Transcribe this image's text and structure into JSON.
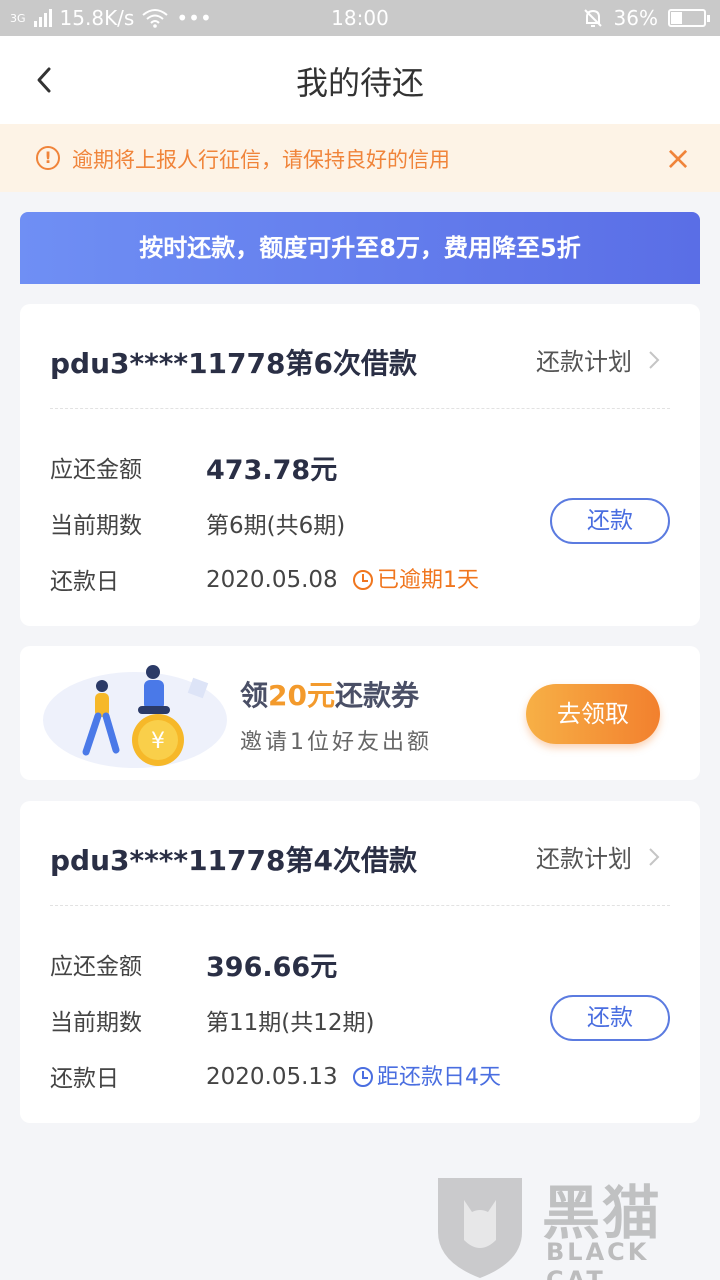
{
  "status_bar": {
    "network": "3G",
    "speed": "15.8K/s",
    "more": "•••",
    "time": "18:00",
    "battery_text": "36%",
    "battery_level": 0.36
  },
  "header": {
    "title": "我的待还"
  },
  "notice": {
    "text": "逾期将上报人行征信，请保持良好的信用"
  },
  "banner": {
    "text": "按时还款，额度可升至8万，费用降至5折"
  },
  "loans": [
    {
      "title": "pdu3****11778第6次借款",
      "plan_label": "还款计划",
      "amount_label": "应还金额",
      "amount": "473.78元",
      "period_label": "当前期数",
      "period": "第6期(共6期)",
      "date_label": "还款日",
      "date": "2020.05.08",
      "status": "已逾期1天",
      "status_color": "#f0761e",
      "button": "还款"
    },
    {
      "title": "pdu3****11778第4次借款",
      "plan_label": "还款计划",
      "amount_label": "应还金额",
      "amount": "396.66元",
      "period_label": "当前期数",
      "period": "第11期(共12期)",
      "date_label": "还款日",
      "date": "2020.05.13",
      "status": "距还款日4天",
      "status_color": "#4a6ee0",
      "button": "还款"
    }
  ],
  "coupon": {
    "title_prefix": "领",
    "title_highlight": "20元",
    "title_suffix": "还款券",
    "subtitle": "邀请1位好友出额",
    "button": "去领取",
    "coin_symbol": "¥"
  },
  "watermark": {
    "cn": "黑猫",
    "en": "BLACK CAT"
  }
}
